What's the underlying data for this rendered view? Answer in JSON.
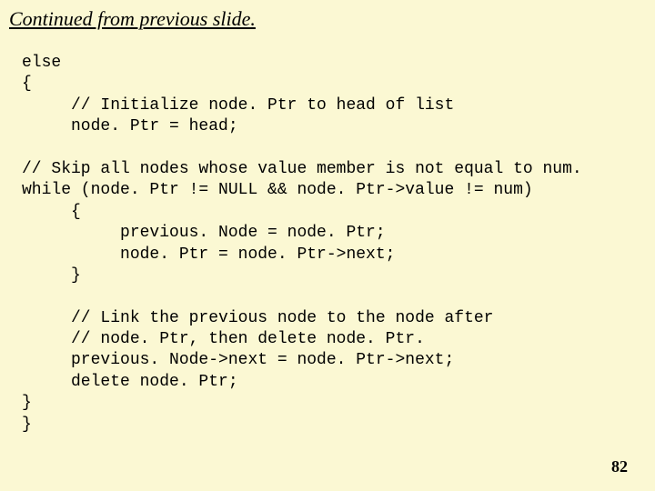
{
  "title": "Continued from previous slide.",
  "code": {
    "l01": "else",
    "l02": "{",
    "l03": "     // Initialize node. Ptr to head of list",
    "l04": "     node. Ptr = head;",
    "l05": "",
    "l06": "// Skip all nodes whose value member is not equal to num.",
    "l07": "while (node. Ptr != NULL && node. Ptr->value != num)",
    "l08": "     {",
    "l09": "          previous. Node = node. Ptr;",
    "l10": "          node. Ptr = node. Ptr->next;",
    "l11": "     }",
    "l12": "",
    "l13": "     // Link the previous node to the node after",
    "l14": "     // node. Ptr, then delete node. Ptr.",
    "l15": "     previous. Node->next = node. Ptr->next;",
    "l16": "     delete node. Ptr;",
    "l17": "}",
    "l18": "}"
  },
  "page_number": "82"
}
